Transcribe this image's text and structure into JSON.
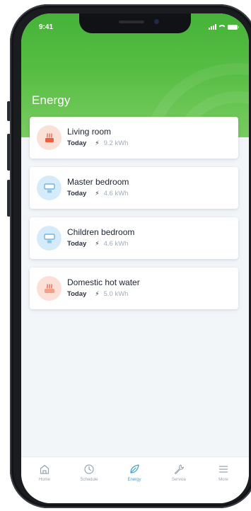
{
  "status_bar": {
    "time": "9:41"
  },
  "page": {
    "title": "Energy"
  },
  "colors": {
    "header_green": "#56bd43",
    "accent_blue": "#3aa0d8",
    "heating_red": "#f08a72",
    "cooling_blue": "#8fc7ee"
  },
  "rooms": [
    {
      "name": "Living room",
      "period": "Today",
      "energy": "9.2 kWh",
      "icon": "radiator-icon",
      "tone": "red"
    },
    {
      "name": "Master bedroom",
      "period": "Today",
      "energy": "4.6 kWh",
      "icon": "air-conditioner-icon",
      "tone": "blue"
    },
    {
      "name": "Children bedroom",
      "period": "Today",
      "energy": "4.6 kWh",
      "icon": "air-conditioner-icon",
      "tone": "blue"
    },
    {
      "name": "Domestic hot water",
      "period": "Today",
      "energy": "5.0 kWh",
      "icon": "water-heater-icon",
      "tone": "red"
    }
  ],
  "nav": {
    "items": [
      {
        "label": "Home",
        "icon": "home-icon",
        "active": false
      },
      {
        "label": "Schedule",
        "icon": "clock-icon",
        "active": false
      },
      {
        "label": "Energy",
        "icon": "leaf-icon",
        "active": true
      },
      {
        "label": "Service",
        "icon": "wrench-icon",
        "active": false
      },
      {
        "label": "More",
        "icon": "menu-icon",
        "active": false
      }
    ]
  }
}
